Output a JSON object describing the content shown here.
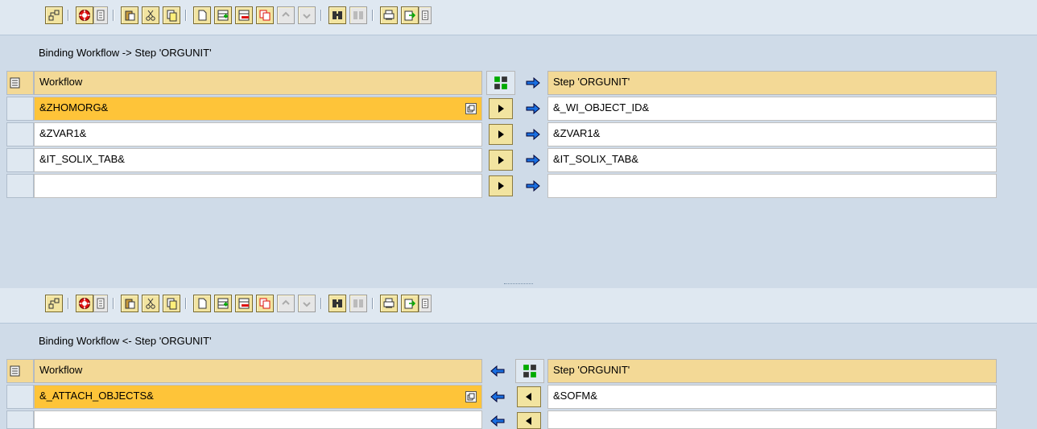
{
  "top": {
    "caption": "Binding Workflow  -> Step 'ORGUNIT'",
    "left_header": "Workflow",
    "right_header": "Step 'ORGUNIT'",
    "rows": [
      {
        "left": "&ZHOMORG&",
        "right": "&_WI_OBJECT_ID&"
      },
      {
        "left": "&ZVAR1&",
        "right": "&ZVAR1&"
      },
      {
        "left": "&IT_SOLIX_TAB&",
        "right": "&IT_SOLIX_TAB&"
      },
      {
        "left": "",
        "right": ""
      }
    ]
  },
  "bottom": {
    "caption": "Binding Workflow  <- Step 'ORGUNIT'",
    "left_header": "Workflow",
    "right_header": "Step 'ORGUNIT'",
    "rows": [
      {
        "left": "&_ATTACH_OBJECTS&",
        "right": "&SOFM&"
      },
      {
        "left": "",
        "right": ""
      }
    ]
  },
  "toolbar_icons": [
    "hierarchy-icon",
    "help-icon",
    "info-icon",
    "paste-icon",
    "cut-icon",
    "copy-icon",
    "new-icon",
    "insert-row-icon",
    "delete-row-icon",
    "duplicate-icon",
    "undo-icon",
    "redo-icon",
    "find-icon",
    "find-next-icon",
    "print-icon",
    "export-icon",
    "settings-icon"
  ],
  "colors": {
    "selected": "#fec439",
    "header": "#f3d996",
    "background": "#cfdbe8"
  }
}
